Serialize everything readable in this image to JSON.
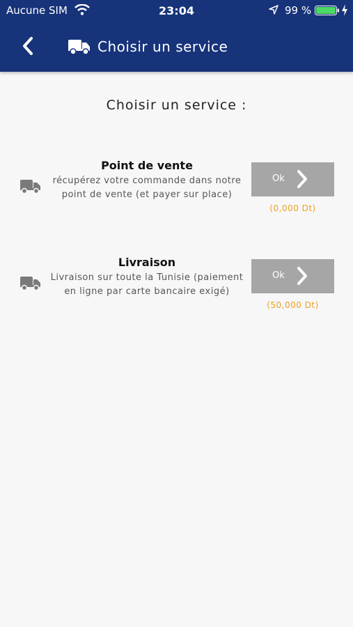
{
  "status_bar": {
    "carrier": "Aucune SIM",
    "time": "23:04",
    "battery_percent": "99 %"
  },
  "nav": {
    "title": "Choisir un service"
  },
  "heading": "Choisir un service :",
  "services": [
    {
      "name": "Point de vente",
      "description": "récupérez votre commande dans notre point de vente (et payer sur place)",
      "button_label": "Ok",
      "price": "(0,000 Dt)"
    },
    {
      "name": "Livraison",
      "description": "Livraison sur toute la Tunisie (paiement en ligne par carte bancaire exigé)",
      "button_label": "Ok",
      "price": "(50,000 Dt)"
    }
  ],
  "colors": {
    "nav_background": "#17337a",
    "button_grey": "#a6a6a6",
    "price_orange": "#f0a020",
    "battery_green": "#4cd964"
  },
  "icons": {
    "back": "chevron-left-icon",
    "header": "truck-icon",
    "service": "truck-icon",
    "button": "chevron-right-icon"
  }
}
